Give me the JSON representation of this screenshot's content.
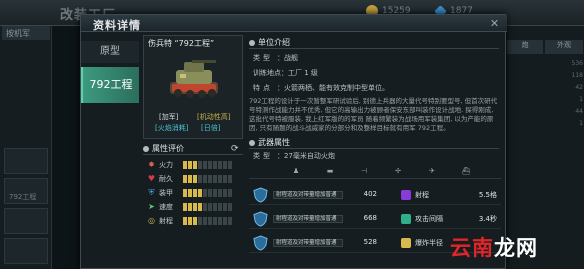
{
  "background": {
    "title": "改装工厂",
    "resources": [
      "15259",
      "1877"
    ],
    "left_selector": "按机军",
    "left_slot_label": "792工程",
    "right_tabs": [
      "炮",
      "外观"
    ],
    "right_values": [
      "536",
      "118",
      "42",
      "1",
      "44",
      "1"
    ]
  },
  "dialog": {
    "title": "资料详情",
    "close_icon": "close-icon",
    "tabs": [
      {
        "label": "原型"
      },
      {
        "label": "792工程"
      }
    ]
  },
  "tank": {
    "name": "伤兵特 “792工程”",
    "tags": [
      "[加军]",
      "[机动性高]",
      "[火焰消耗]",
      "[日倍]"
    ]
  },
  "attributes": {
    "header": "属性评价",
    "items": [
      {
        "icon": "firepower-icon",
        "label": "火力",
        "value": 3,
        "max": 10,
        "color": "#d8624a"
      },
      {
        "icon": "hp-heart-icon",
        "label": "耐久",
        "value": 3,
        "max": 10,
        "color": "#d83a4a"
      },
      {
        "icon": "armor-icon",
        "label": "装甲",
        "value": 4,
        "max": 10,
        "color": "#4aa0d8"
      },
      {
        "icon": "mobility-icon",
        "label": "速度",
        "value": 4,
        "max": 10,
        "color": "#5ac46a"
      },
      {
        "icon": "range-icon",
        "label": "射程",
        "value": 3,
        "max": 10,
        "color": "#c4b44a"
      }
    ]
  },
  "unit_info": {
    "header": "单位介绍",
    "rows": [
      {
        "key": "类型",
        "value": "战舰"
      },
      {
        "key": "训练地点",
        "value": "工厂 1 级"
      },
      {
        "key": "特点",
        "value": "火箭两栖、能有效克制中型单位。"
      }
    ],
    "description": "792工程的设计于一次暂整军研试验后, 别德上兵器的大量代号特别要型号, 但首次研代号特测作战能力并不优秀, 但它的高输出力被顾者保安东部叫装作设计战地. 探得刚成, 这批代号特被服装, 我上红军版的的军员 随着频繁装为战场用军装集团, 以为产能的原因, 只有随题的战斗战威家的分部分和及整样目标就有用军 792工程。"
  },
  "weapon": {
    "header": "武器属性",
    "type_key": "类型",
    "type_value": "27毫米自动火炮",
    "icons": [
      "infantry-icon",
      "tank-icon",
      "artillery-icon",
      "helicopter-icon",
      "plane-icon",
      "ship-icon"
    ],
    "rows": [
      {
        "bar_label": "射程道及对带量增加普通",
        "value": "402",
        "stat_icon": "range-icon",
        "stat_label": "射程",
        "stat_value": "5.5格"
      },
      {
        "bar_label": "射程道及对带量增加普通",
        "value": "668",
        "stat_icon": "rate-icon",
        "stat_label": "攻击间隔",
        "stat_value": "3.4秒"
      },
      {
        "bar_label": "射程道及对带量增加普通",
        "value": "528",
        "stat_icon": "splash-icon",
        "stat_label": "爆炸半径",
        "stat_value": ""
      }
    ]
  },
  "watermark": {
    "red": "云南",
    "white": "龙网"
  },
  "colors": {
    "accent": "#3c9a7e",
    "bar_on": "#d8b94c",
    "panel": "#161d20"
  }
}
